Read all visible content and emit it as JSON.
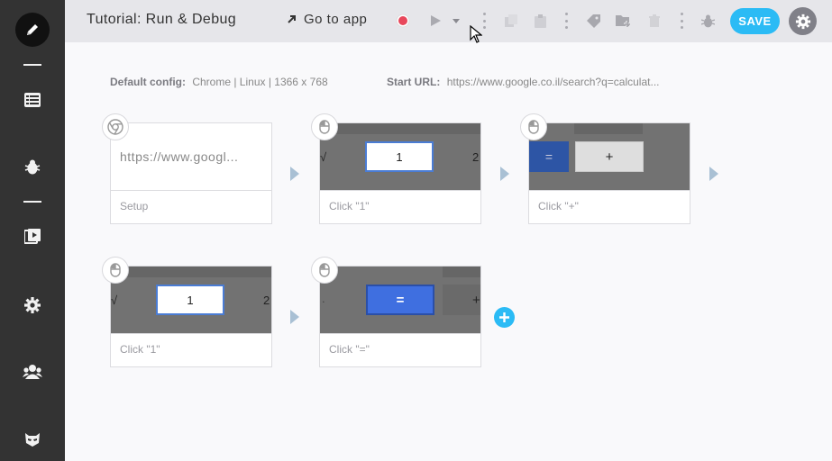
{
  "header": {
    "title": "Tutorial: Run & Debug",
    "goto_label": "Go to app",
    "save_label": "SAVE"
  },
  "config": {
    "default_label": "Default config:",
    "default_value": "Chrome | Linux | 1366 x 768",
    "start_label": "Start URL:",
    "start_value": "https://www.google.co.il/search?q=calculat..."
  },
  "steps": [
    {
      "label": "Setup",
      "url": "https://www.googl...",
      "icon": "chrome-icon"
    },
    {
      "label": "Click \"1\"",
      "thumb_text": "1",
      "left_glyph": "√",
      "right_glyph": "2",
      "icon": "mouse-icon"
    },
    {
      "label": "Click \"+\"",
      "thumb_text": "+",
      "left_glyph": "=",
      "icon": "mouse-icon"
    },
    {
      "label": "Click \"1\"",
      "thumb_text": "1",
      "left_glyph": "√",
      "right_glyph": "2",
      "icon": "mouse-icon"
    },
    {
      "label": "Click \"=\"",
      "thumb_text": "=",
      "left_glyph": ".",
      "right_glyph": "+",
      "icon": "mouse-icon"
    }
  ],
  "colors": {
    "sidebar": "#333333",
    "topbar": "#e6e6ea",
    "accent": "#2bbbf5",
    "record": "#e8475b"
  }
}
